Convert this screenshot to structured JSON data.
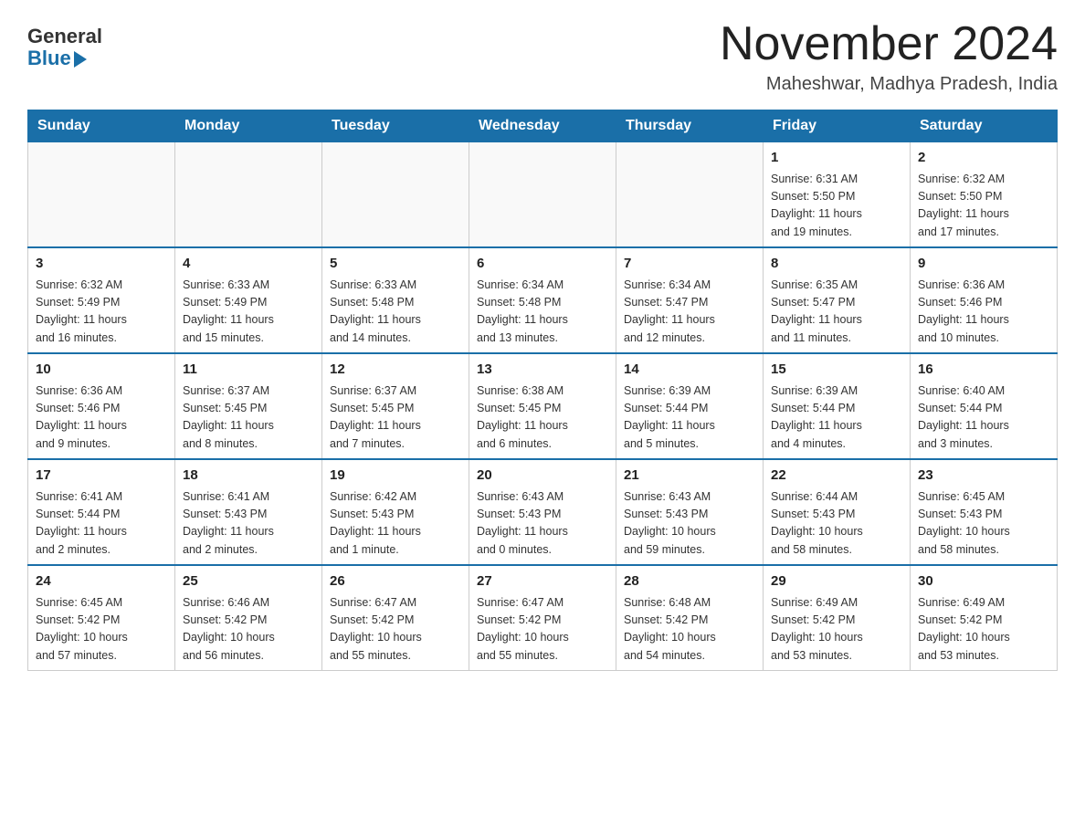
{
  "header": {
    "logo_general": "General",
    "logo_blue": "Blue",
    "month_title": "November 2024",
    "location": "Maheshwar, Madhya Pradesh, India"
  },
  "weekdays": [
    "Sunday",
    "Monday",
    "Tuesday",
    "Wednesday",
    "Thursday",
    "Friday",
    "Saturday"
  ],
  "weeks": [
    [
      {
        "day": "",
        "info": ""
      },
      {
        "day": "",
        "info": ""
      },
      {
        "day": "",
        "info": ""
      },
      {
        "day": "",
        "info": ""
      },
      {
        "day": "",
        "info": ""
      },
      {
        "day": "1",
        "info": "Sunrise: 6:31 AM\nSunset: 5:50 PM\nDaylight: 11 hours\nand 19 minutes."
      },
      {
        "day": "2",
        "info": "Sunrise: 6:32 AM\nSunset: 5:50 PM\nDaylight: 11 hours\nand 17 minutes."
      }
    ],
    [
      {
        "day": "3",
        "info": "Sunrise: 6:32 AM\nSunset: 5:49 PM\nDaylight: 11 hours\nand 16 minutes."
      },
      {
        "day": "4",
        "info": "Sunrise: 6:33 AM\nSunset: 5:49 PM\nDaylight: 11 hours\nand 15 minutes."
      },
      {
        "day": "5",
        "info": "Sunrise: 6:33 AM\nSunset: 5:48 PM\nDaylight: 11 hours\nand 14 minutes."
      },
      {
        "day": "6",
        "info": "Sunrise: 6:34 AM\nSunset: 5:48 PM\nDaylight: 11 hours\nand 13 minutes."
      },
      {
        "day": "7",
        "info": "Sunrise: 6:34 AM\nSunset: 5:47 PM\nDaylight: 11 hours\nand 12 minutes."
      },
      {
        "day": "8",
        "info": "Sunrise: 6:35 AM\nSunset: 5:47 PM\nDaylight: 11 hours\nand 11 minutes."
      },
      {
        "day": "9",
        "info": "Sunrise: 6:36 AM\nSunset: 5:46 PM\nDaylight: 11 hours\nand 10 minutes."
      }
    ],
    [
      {
        "day": "10",
        "info": "Sunrise: 6:36 AM\nSunset: 5:46 PM\nDaylight: 11 hours\nand 9 minutes."
      },
      {
        "day": "11",
        "info": "Sunrise: 6:37 AM\nSunset: 5:45 PM\nDaylight: 11 hours\nand 8 minutes."
      },
      {
        "day": "12",
        "info": "Sunrise: 6:37 AM\nSunset: 5:45 PM\nDaylight: 11 hours\nand 7 minutes."
      },
      {
        "day": "13",
        "info": "Sunrise: 6:38 AM\nSunset: 5:45 PM\nDaylight: 11 hours\nand 6 minutes."
      },
      {
        "day": "14",
        "info": "Sunrise: 6:39 AM\nSunset: 5:44 PM\nDaylight: 11 hours\nand 5 minutes."
      },
      {
        "day": "15",
        "info": "Sunrise: 6:39 AM\nSunset: 5:44 PM\nDaylight: 11 hours\nand 4 minutes."
      },
      {
        "day": "16",
        "info": "Sunrise: 6:40 AM\nSunset: 5:44 PM\nDaylight: 11 hours\nand 3 minutes."
      }
    ],
    [
      {
        "day": "17",
        "info": "Sunrise: 6:41 AM\nSunset: 5:44 PM\nDaylight: 11 hours\nand 2 minutes."
      },
      {
        "day": "18",
        "info": "Sunrise: 6:41 AM\nSunset: 5:43 PM\nDaylight: 11 hours\nand 2 minutes."
      },
      {
        "day": "19",
        "info": "Sunrise: 6:42 AM\nSunset: 5:43 PM\nDaylight: 11 hours\nand 1 minute."
      },
      {
        "day": "20",
        "info": "Sunrise: 6:43 AM\nSunset: 5:43 PM\nDaylight: 11 hours\nand 0 minutes."
      },
      {
        "day": "21",
        "info": "Sunrise: 6:43 AM\nSunset: 5:43 PM\nDaylight: 10 hours\nand 59 minutes."
      },
      {
        "day": "22",
        "info": "Sunrise: 6:44 AM\nSunset: 5:43 PM\nDaylight: 10 hours\nand 58 minutes."
      },
      {
        "day": "23",
        "info": "Sunrise: 6:45 AM\nSunset: 5:43 PM\nDaylight: 10 hours\nand 58 minutes."
      }
    ],
    [
      {
        "day": "24",
        "info": "Sunrise: 6:45 AM\nSunset: 5:42 PM\nDaylight: 10 hours\nand 57 minutes."
      },
      {
        "day": "25",
        "info": "Sunrise: 6:46 AM\nSunset: 5:42 PM\nDaylight: 10 hours\nand 56 minutes."
      },
      {
        "day": "26",
        "info": "Sunrise: 6:47 AM\nSunset: 5:42 PM\nDaylight: 10 hours\nand 55 minutes."
      },
      {
        "day": "27",
        "info": "Sunrise: 6:47 AM\nSunset: 5:42 PM\nDaylight: 10 hours\nand 55 minutes."
      },
      {
        "day": "28",
        "info": "Sunrise: 6:48 AM\nSunset: 5:42 PM\nDaylight: 10 hours\nand 54 minutes."
      },
      {
        "day": "29",
        "info": "Sunrise: 6:49 AM\nSunset: 5:42 PM\nDaylight: 10 hours\nand 53 minutes."
      },
      {
        "day": "30",
        "info": "Sunrise: 6:49 AM\nSunset: 5:42 PM\nDaylight: 10 hours\nand 53 minutes."
      }
    ]
  ]
}
